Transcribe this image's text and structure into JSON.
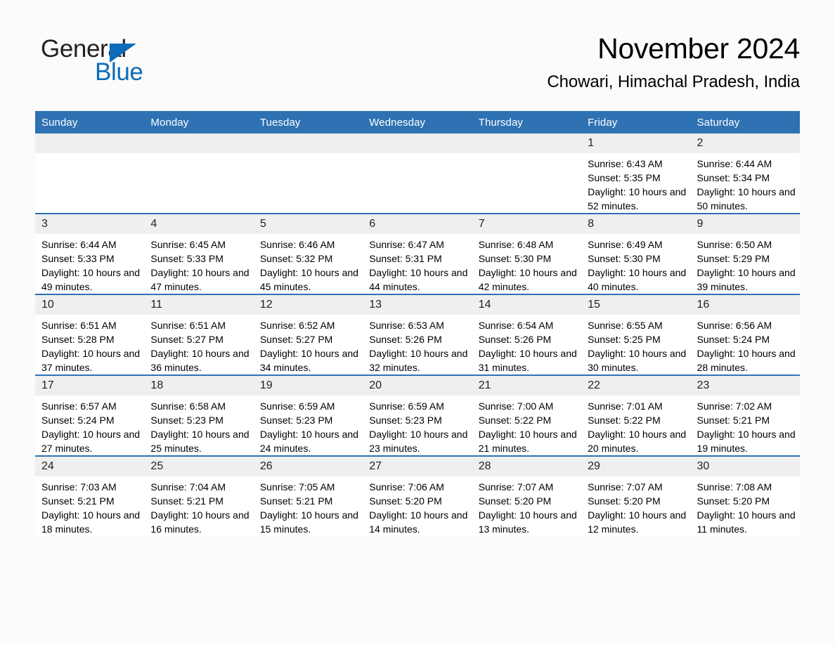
{
  "brand": {
    "name_part1": "General",
    "name_part2": "Blue",
    "accent_color": "#0d6cb9"
  },
  "header": {
    "title": "November 2024",
    "subtitle": "Chowari, Himachal Pradesh, India"
  },
  "theme": {
    "header_blue": "#2e72b3",
    "daynum_band": "#efefef",
    "page_background": "#fbfbfb"
  },
  "labels": {
    "sunrise_prefix": "Sunrise:",
    "sunset_prefix": "Sunset:",
    "daylight_prefix": "Daylight:"
  },
  "weekdays": [
    "Sunday",
    "Monday",
    "Tuesday",
    "Wednesday",
    "Thursday",
    "Friday",
    "Saturday"
  ],
  "weeks": [
    [
      {
        "day": "",
        "lines": []
      },
      {
        "day": "",
        "lines": []
      },
      {
        "day": "",
        "lines": []
      },
      {
        "day": "",
        "lines": []
      },
      {
        "day": "",
        "lines": []
      },
      {
        "day": "1",
        "lines": [
          "Sunrise: 6:43 AM",
          "Sunset: 5:35 PM",
          "Daylight: 10 hours and 52 minutes."
        ]
      },
      {
        "day": "2",
        "lines": [
          "Sunrise: 6:44 AM",
          "Sunset: 5:34 PM",
          "Daylight: 10 hours and 50 minutes."
        ]
      }
    ],
    [
      {
        "day": "3",
        "lines": [
          "Sunrise: 6:44 AM",
          "Sunset: 5:33 PM",
          "Daylight: 10 hours and 49 minutes."
        ]
      },
      {
        "day": "4",
        "lines": [
          "Sunrise: 6:45 AM",
          "Sunset: 5:33 PM",
          "Daylight: 10 hours and 47 minutes."
        ]
      },
      {
        "day": "5",
        "lines": [
          "Sunrise: 6:46 AM",
          "Sunset: 5:32 PM",
          "Daylight: 10 hours and 45 minutes."
        ]
      },
      {
        "day": "6",
        "lines": [
          "Sunrise: 6:47 AM",
          "Sunset: 5:31 PM",
          "Daylight: 10 hours and 44 minutes."
        ]
      },
      {
        "day": "7",
        "lines": [
          "Sunrise: 6:48 AM",
          "Sunset: 5:30 PM",
          "Daylight: 10 hours and 42 minutes."
        ]
      },
      {
        "day": "8",
        "lines": [
          "Sunrise: 6:49 AM",
          "Sunset: 5:30 PM",
          "Daylight: 10 hours and 40 minutes."
        ]
      },
      {
        "day": "9",
        "lines": [
          "Sunrise: 6:50 AM",
          "Sunset: 5:29 PM",
          "Daylight: 10 hours and 39 minutes."
        ]
      }
    ],
    [
      {
        "day": "10",
        "lines": [
          "Sunrise: 6:51 AM",
          "Sunset: 5:28 PM",
          "Daylight: 10 hours and 37 minutes."
        ]
      },
      {
        "day": "11",
        "lines": [
          "Sunrise: 6:51 AM",
          "Sunset: 5:27 PM",
          "Daylight: 10 hours and 36 minutes."
        ]
      },
      {
        "day": "12",
        "lines": [
          "Sunrise: 6:52 AM",
          "Sunset: 5:27 PM",
          "Daylight: 10 hours and 34 minutes."
        ]
      },
      {
        "day": "13",
        "lines": [
          "Sunrise: 6:53 AM",
          "Sunset: 5:26 PM",
          "Daylight: 10 hours and 32 minutes."
        ]
      },
      {
        "day": "14",
        "lines": [
          "Sunrise: 6:54 AM",
          "Sunset: 5:26 PM",
          "Daylight: 10 hours and 31 minutes."
        ]
      },
      {
        "day": "15",
        "lines": [
          "Sunrise: 6:55 AM",
          "Sunset: 5:25 PM",
          "Daylight: 10 hours and 30 minutes."
        ]
      },
      {
        "day": "16",
        "lines": [
          "Sunrise: 6:56 AM",
          "Sunset: 5:24 PM",
          "Daylight: 10 hours and 28 minutes."
        ]
      }
    ],
    [
      {
        "day": "17",
        "lines": [
          "Sunrise: 6:57 AM",
          "Sunset: 5:24 PM",
          "Daylight: 10 hours and 27 minutes."
        ]
      },
      {
        "day": "18",
        "lines": [
          "Sunrise: 6:58 AM",
          "Sunset: 5:23 PM",
          "Daylight: 10 hours and 25 minutes."
        ]
      },
      {
        "day": "19",
        "lines": [
          "Sunrise: 6:59 AM",
          "Sunset: 5:23 PM",
          "Daylight: 10 hours and 24 minutes."
        ]
      },
      {
        "day": "20",
        "lines": [
          "Sunrise: 6:59 AM",
          "Sunset: 5:23 PM",
          "Daylight: 10 hours and 23 minutes."
        ]
      },
      {
        "day": "21",
        "lines": [
          "Sunrise: 7:00 AM",
          "Sunset: 5:22 PM",
          "Daylight: 10 hours and 21 minutes."
        ]
      },
      {
        "day": "22",
        "lines": [
          "Sunrise: 7:01 AM",
          "Sunset: 5:22 PM",
          "Daylight: 10 hours and 20 minutes."
        ]
      },
      {
        "day": "23",
        "lines": [
          "Sunrise: 7:02 AM",
          "Sunset: 5:21 PM",
          "Daylight: 10 hours and 19 minutes."
        ]
      }
    ],
    [
      {
        "day": "24",
        "lines": [
          "Sunrise: 7:03 AM",
          "Sunset: 5:21 PM",
          "Daylight: 10 hours and 18 minutes."
        ]
      },
      {
        "day": "25",
        "lines": [
          "Sunrise: 7:04 AM",
          "Sunset: 5:21 PM",
          "Daylight: 10 hours and 16 minutes."
        ]
      },
      {
        "day": "26",
        "lines": [
          "Sunrise: 7:05 AM",
          "Sunset: 5:21 PM",
          "Daylight: 10 hours and 15 minutes."
        ]
      },
      {
        "day": "27",
        "lines": [
          "Sunrise: 7:06 AM",
          "Sunset: 5:20 PM",
          "Daylight: 10 hours and 14 minutes."
        ]
      },
      {
        "day": "28",
        "lines": [
          "Sunrise: 7:07 AM",
          "Sunset: 5:20 PM",
          "Daylight: 10 hours and 13 minutes."
        ]
      },
      {
        "day": "29",
        "lines": [
          "Sunrise: 7:07 AM",
          "Sunset: 5:20 PM",
          "Daylight: 10 hours and 12 minutes."
        ]
      },
      {
        "day": "30",
        "lines": [
          "Sunrise: 7:08 AM",
          "Sunset: 5:20 PM",
          "Daylight: 10 hours and 11 minutes."
        ]
      }
    ]
  ]
}
